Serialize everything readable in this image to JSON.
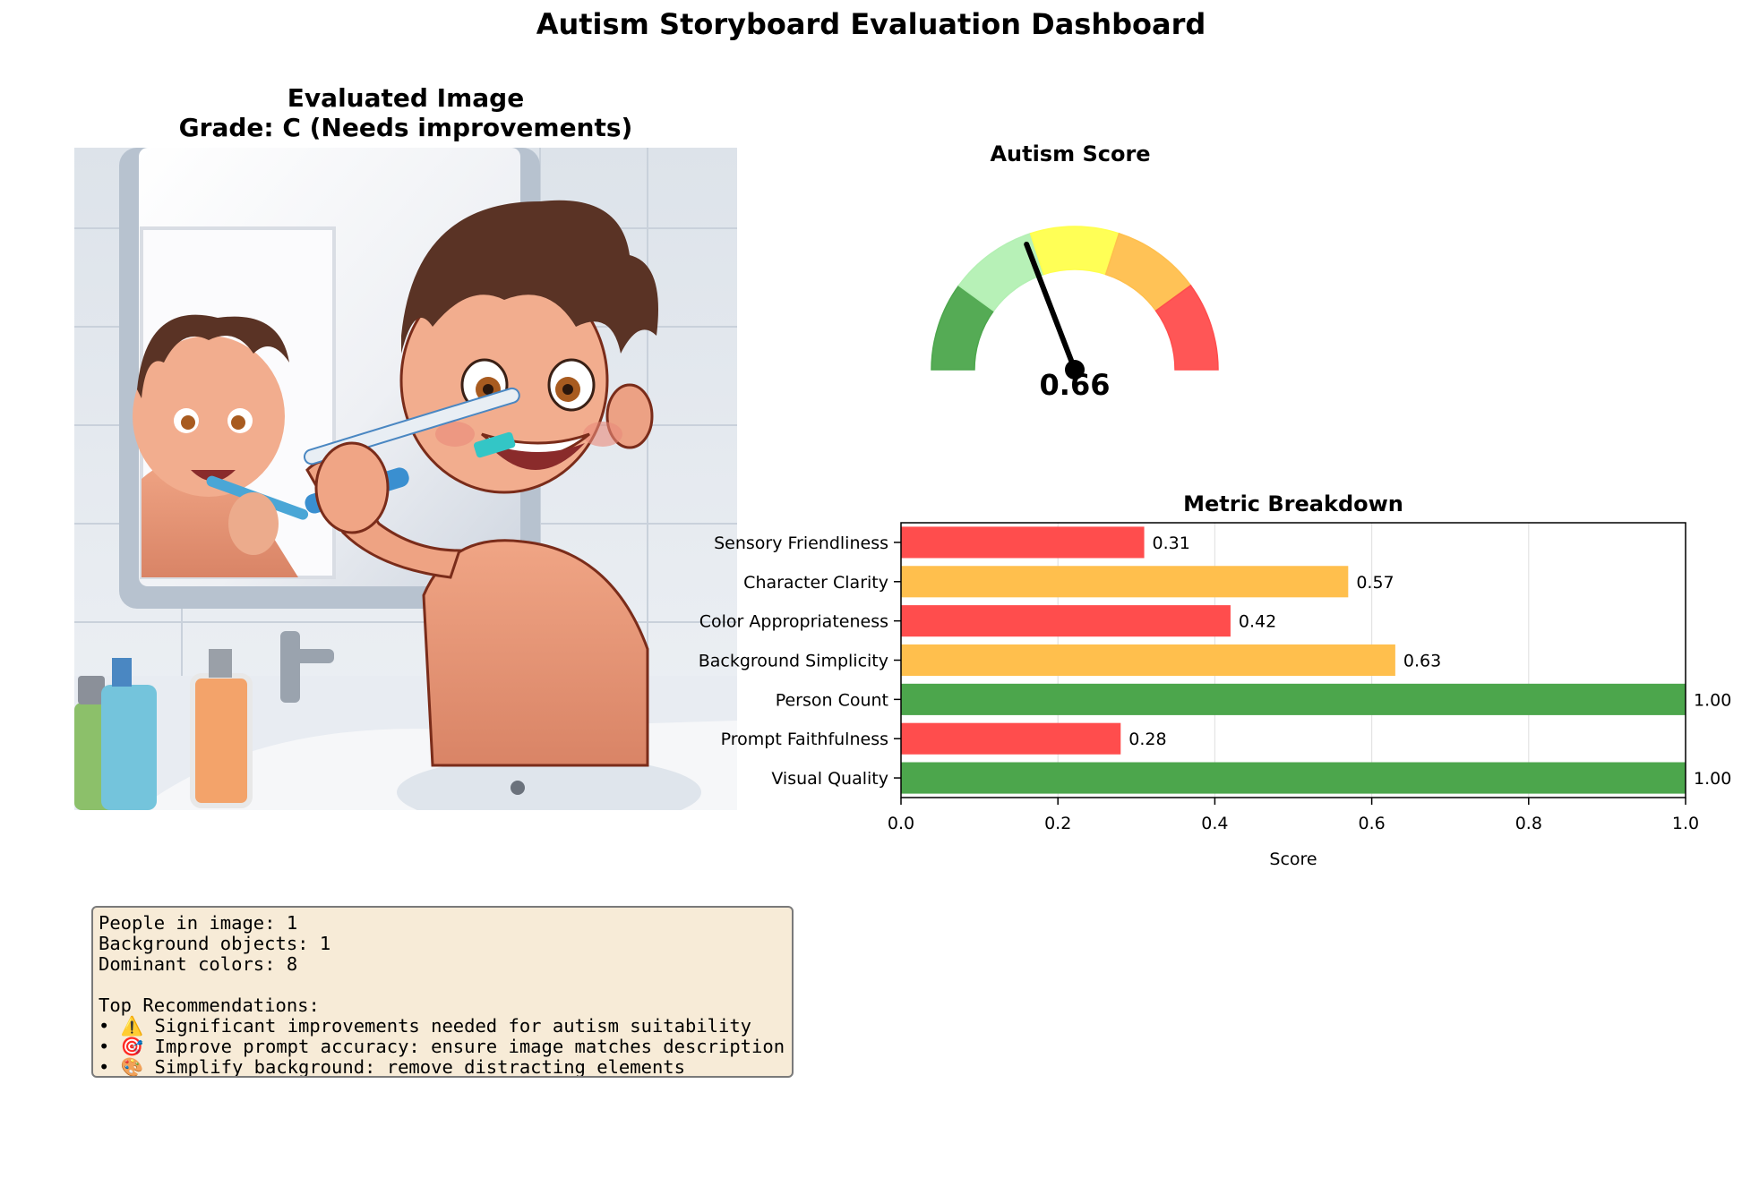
{
  "dashboard": {
    "title": "Autism Storyboard Evaluation Dashboard"
  },
  "image_panel": {
    "title": "Evaluated Image",
    "grade_line": "Grade: C (Needs improvements)"
  },
  "gauge": {
    "title": "Autism Score",
    "value": 0.66,
    "value_label": "0.66",
    "segment_colors": [
      "#4ca64c",
      "#b3f0b3",
      "#ffff4d",
      "#ffbf4d",
      "#ff4d4d"
    ]
  },
  "chart_data": {
    "type": "bar",
    "orientation": "horizontal",
    "title": "Metric Breakdown",
    "xlabel": "Score",
    "ylabel": "",
    "xlim": [
      0,
      1.0
    ],
    "xticks": [
      "0.0",
      "0.2",
      "0.4",
      "0.6",
      "0.8",
      "1.0"
    ],
    "grid": true,
    "categories": [
      "Sensory Friendliness",
      "Character Clarity",
      "Color Appropriateness",
      "Background Simplicity",
      "Person Count",
      "Prompt Faithfulness",
      "Visual Quality"
    ],
    "values": [
      0.31,
      0.57,
      0.42,
      0.63,
      1.0,
      0.28,
      1.0
    ],
    "value_labels": [
      "0.31",
      "0.57",
      "0.42",
      "0.63",
      "1.00",
      "0.28",
      "1.00"
    ],
    "bar_colors": [
      "#ff4d4d",
      "#ffbf4d",
      "#ff4d4d",
      "#ffbf4d",
      "#4ca64c",
      "#ff4d4d",
      "#4ca64c"
    ]
  },
  "info": {
    "people": "People in image: 1",
    "background_objects": "Background objects: 1",
    "dominant_colors": "Dominant colors: 8",
    "recommendations_header": "Top Recommendations:",
    "recommendations": [
      "• ⚠️ Significant improvements needed for autism suitability",
      "• 🎯 Improve prompt accuracy: ensure image matches description",
      "• 🎨 Simplify background: remove distracting elements"
    ]
  }
}
